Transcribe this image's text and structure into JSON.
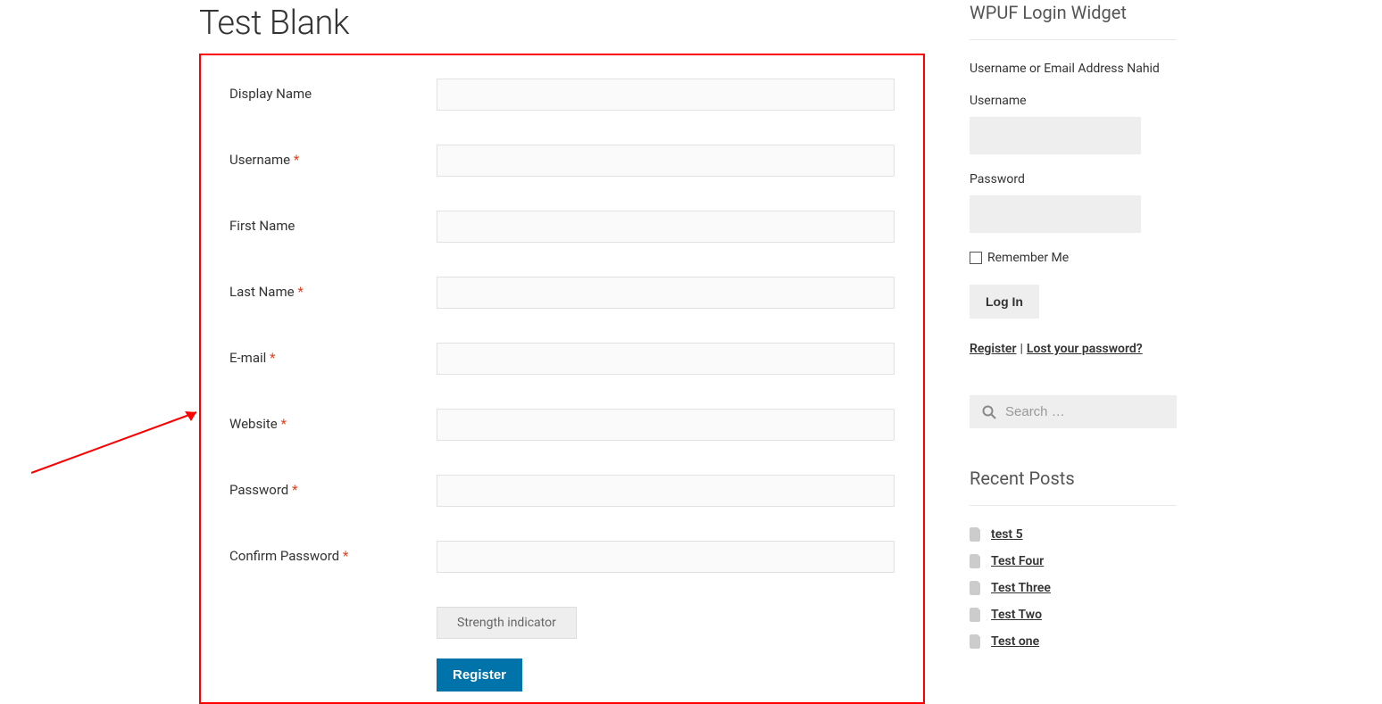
{
  "page_title": "Test Blank",
  "form": {
    "fields": [
      {
        "label": "Display Name",
        "required": false
      },
      {
        "label": "Username",
        "required": true
      },
      {
        "label": "First Name",
        "required": false
      },
      {
        "label": "Last Name",
        "required": true
      },
      {
        "label": "E-mail",
        "required": true
      },
      {
        "label": "Website",
        "required": true
      },
      {
        "label": "Password",
        "required": true
      },
      {
        "label": "Confirm Password",
        "required": true
      }
    ],
    "strength_label": "Strength indicator",
    "submit_label": "Register"
  },
  "sidebar": {
    "login": {
      "title": "WPUF Login Widget",
      "desc": "Username or Email Address Nahid",
      "username_label": "Username",
      "password_label": "Password",
      "remember_label": "Remember Me",
      "login_button": "Log In",
      "register_link": "Register",
      "lost_link": "Lost your password?"
    },
    "search_placeholder": "Search …",
    "recent": {
      "title": "Recent Posts",
      "items": [
        "test 5",
        "Test Four",
        "Test Three",
        "Test Two",
        "Test one"
      ]
    }
  }
}
